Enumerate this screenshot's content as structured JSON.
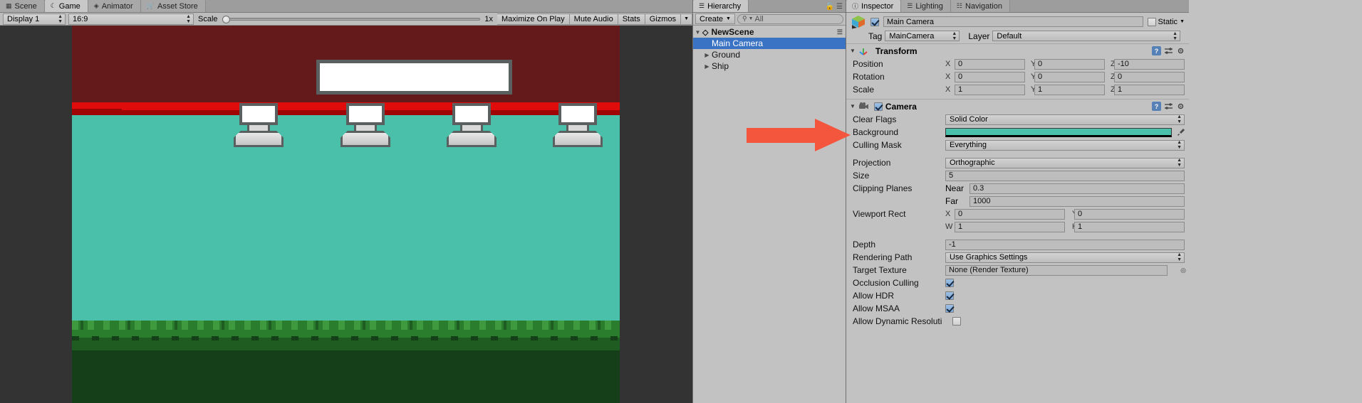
{
  "game_panel": {
    "tabs": [
      {
        "label": "Scene",
        "icon": "grid-icon",
        "active": false
      },
      {
        "label": "Game",
        "icon": "gamepad-icon",
        "active": true
      },
      {
        "label": "Animator",
        "icon": "animator-icon",
        "active": false
      },
      {
        "label": "Asset Store",
        "icon": "store-icon",
        "active": false
      }
    ],
    "toolbar": {
      "display": "Display 1",
      "aspect": "16:9",
      "scale_label": "Scale",
      "scale_value": "1x",
      "maximize_on_play": "Maximize On Play",
      "mute_audio": "Mute Audio",
      "stats": "Stats",
      "gizmos": "Gizmos"
    },
    "scene_art": {
      "sky_color": "#641a1a",
      "stripe_color": "#e00b0b",
      "background_color": "#4ac0ab",
      "grass_color": "#2b7d2e",
      "pedestal_count": 4
    }
  },
  "hierarchy": {
    "tab": "Hierarchy",
    "tab_icon": "hierarchy-icon",
    "create_label": "Create",
    "search_placeholder": "All",
    "items": [
      {
        "label": "NewScene",
        "depth": 0,
        "expanded": true,
        "selected": false,
        "is_scene": true
      },
      {
        "label": "Main Camera",
        "depth": 1,
        "expanded": false,
        "selected": true,
        "is_scene": false
      },
      {
        "label": "Ground",
        "depth": 1,
        "expanded": false,
        "selected": false,
        "is_scene": false
      },
      {
        "label": "Ship",
        "depth": 1,
        "expanded": false,
        "selected": false,
        "is_scene": false
      }
    ]
  },
  "inspector": {
    "tabs": [
      {
        "label": "Inspector",
        "icon": "info-icon",
        "active": true
      },
      {
        "label": "Lighting",
        "icon": "lighting-icon",
        "active": false
      },
      {
        "label": "Navigation",
        "icon": "navigation-icon",
        "active": false
      }
    ],
    "object_name": "Main Camera",
    "object_enabled": true,
    "static_label": "Static",
    "static_checked": false,
    "tag_label": "Tag",
    "tag_value": "MainCamera",
    "layer_label": "Layer",
    "layer_value": "Default",
    "transform": {
      "title": "Transform",
      "rows": [
        {
          "label": "Position",
          "x": "0",
          "y": "0",
          "z": "-10"
        },
        {
          "label": "Rotation",
          "x": "0",
          "y": "0",
          "z": "0"
        },
        {
          "label": "Scale",
          "x": "1",
          "y": "1",
          "z": "1"
        }
      ],
      "axis_x": "X",
      "axis_y": "Y",
      "axis_z": "Z"
    },
    "camera": {
      "title": "Camera",
      "enabled": true,
      "clear_flags_label": "Clear Flags",
      "clear_flags_value": "Solid Color",
      "background_label": "Background",
      "background_color": "#4ac0ab",
      "culling_mask_label": "Culling Mask",
      "culling_mask_value": "Everything",
      "projection_label": "Projection",
      "projection_value": "Orthographic",
      "size_label": "Size",
      "size_value": "5",
      "clipping_label": "Clipping Planes",
      "near_label": "Near",
      "near_value": "0.3",
      "far_label": "Far",
      "far_value": "1000",
      "viewport_label": "Viewport Rect",
      "viewport_x_label": "X",
      "viewport_x": "0",
      "viewport_y_label": "Y",
      "viewport_y": "0",
      "viewport_w_label": "W",
      "viewport_w": "1",
      "viewport_h_label": "H",
      "viewport_h": "1",
      "depth_label": "Depth",
      "depth_value": "-1",
      "rendering_path_label": "Rendering Path",
      "rendering_path_value": "Use Graphics Settings",
      "target_texture_label": "Target Texture",
      "target_texture_value": "None (Render Texture)",
      "occlusion_label": "Occlusion Culling",
      "occlusion_checked": true,
      "hdr_label": "Allow HDR",
      "hdr_checked": true,
      "msaa_label": "Allow MSAA",
      "msaa_checked": true,
      "dynres_label": "Allow Dynamic Resoluti",
      "dynres_checked": false
    }
  },
  "annotation": {
    "arrow_color": "#f4553d",
    "points_to": "Background"
  }
}
